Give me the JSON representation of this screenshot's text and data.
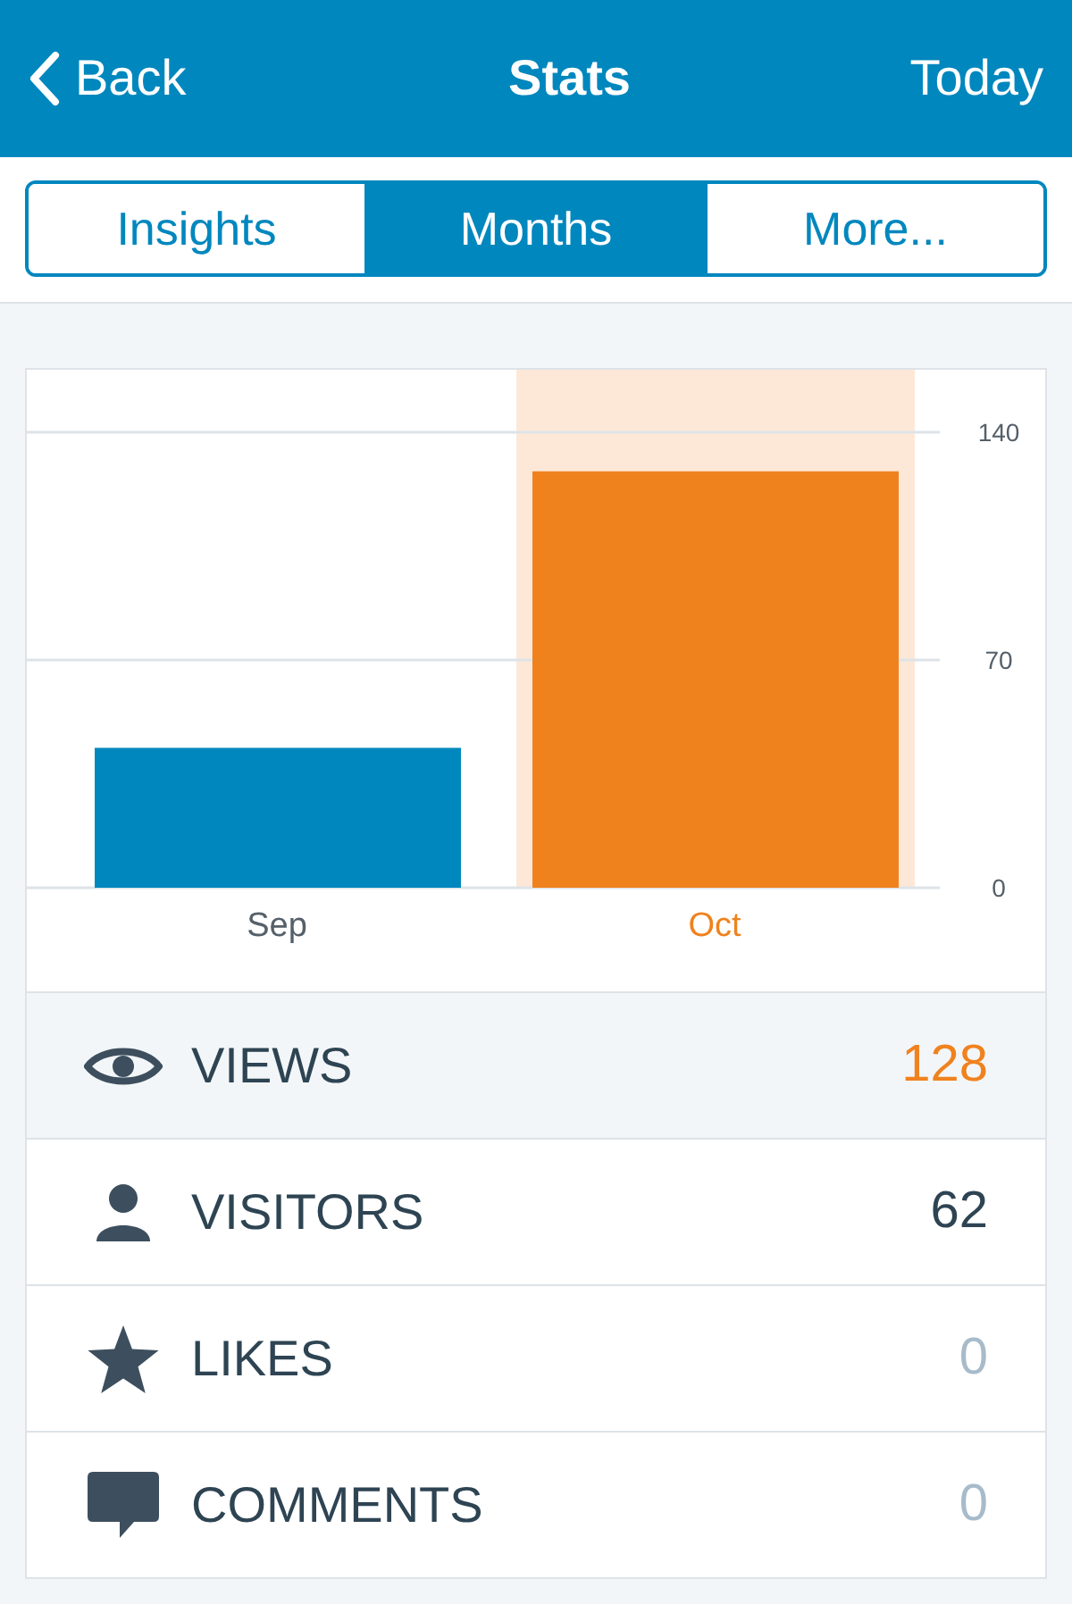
{
  "header": {
    "back": "Back",
    "title": "Stats",
    "action": "Today"
  },
  "tabs": [
    {
      "label": "Insights",
      "selected": false
    },
    {
      "label": "Months",
      "selected": true
    },
    {
      "label": "More...",
      "selected": false
    }
  ],
  "chart": {
    "chart_data": {
      "type": "bar",
      "categories": [
        "Sep",
        "Oct"
      ],
      "stacked": true,
      "series": [
        {
          "color": "#0087be",
          "values": [
            43,
            null
          ]
        },
        {
          "color": "#f0821e",
          "values": [
            null,
            128
          ]
        }
      ],
      "ylim": [
        0,
        140
      ],
      "yticks": [
        0,
        70,
        140
      ]
    },
    "columns": [
      {
        "selected": false
      },
      {
        "selected": true
      }
    ]
  },
  "stats": [
    {
      "kind": "views",
      "label": "VIEWS",
      "value": "128",
      "selected": true,
      "muted": false
    },
    {
      "kind": "visitors",
      "label": "VISITORS",
      "value": "62",
      "selected": false,
      "muted": false
    },
    {
      "kind": "likes",
      "label": "LIKES",
      "value": "0",
      "selected": false,
      "muted": true
    },
    {
      "kind": "comments",
      "label": "COMMENTS",
      "value": "0",
      "selected": false,
      "muted": true
    }
  ]
}
